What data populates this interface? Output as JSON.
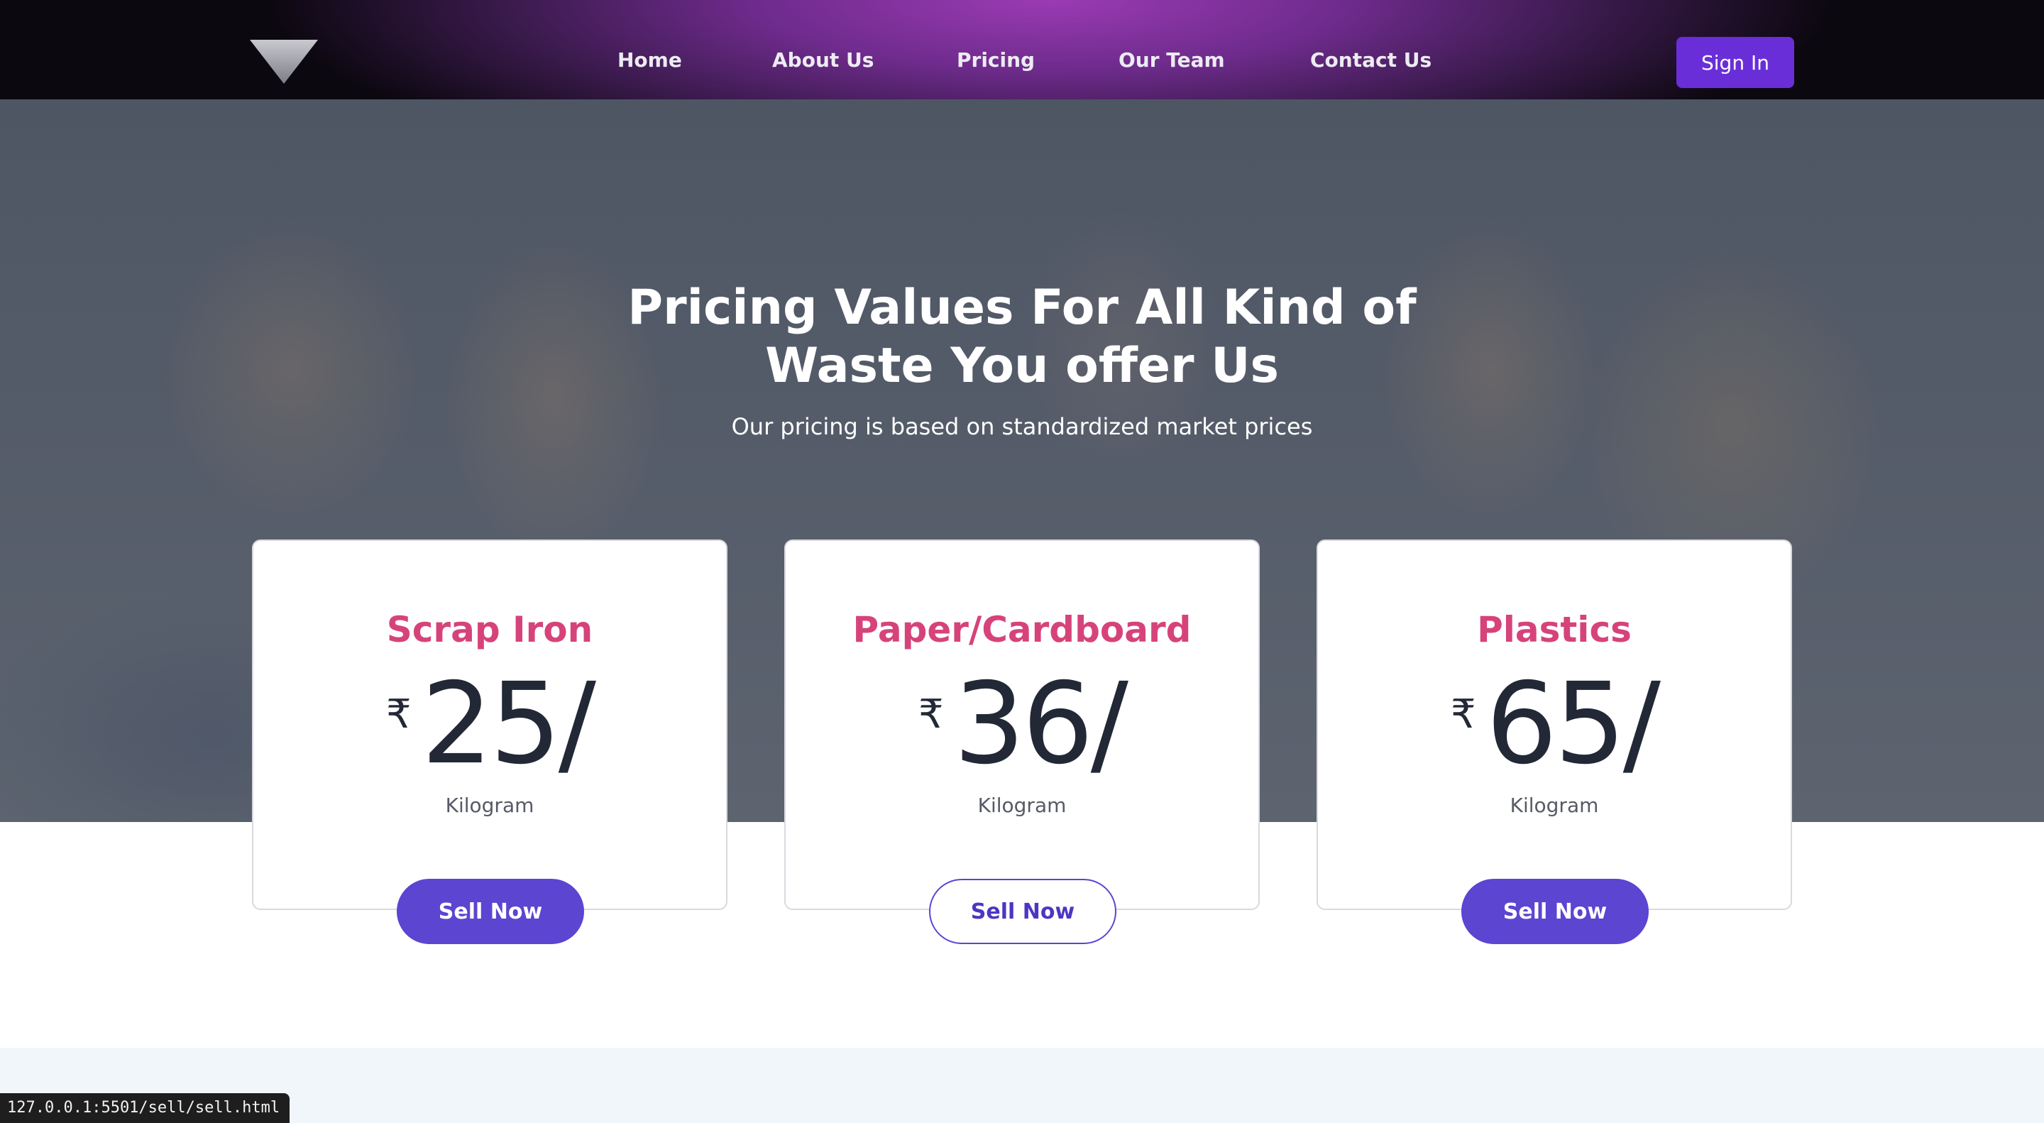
{
  "nav": {
    "logo_icon": "triangle-logo-icon",
    "links": [
      "Home",
      "About Us",
      "Pricing",
      "Our Team",
      "Contact Us"
    ],
    "signin_label": "Sign In",
    "signin_color": "#6a2ed8"
  },
  "hero": {
    "title": "Pricing Values For All Kind of Waste You offer Us",
    "subtitle": "Our pricing is based on standardized market prices"
  },
  "cards": [
    {
      "name": "Scrap Iron",
      "currency": "₹",
      "amount": "25/",
      "unit": "Kilogram",
      "button": "Sell Now",
      "button_style": "solid"
    },
    {
      "name": "Paper/Cardboard",
      "currency": "₹",
      "amount": "36/",
      "unit": "Kilogram",
      "button": "Sell Now",
      "button_style": "outline"
    },
    {
      "name": "Plastics",
      "currency": "₹",
      "amount": "65/",
      "unit": "Kilogram",
      "button": "Sell Now",
      "button_style": "solid"
    }
  ],
  "colors": {
    "accent": "#5b45d1",
    "card_title": "#d6437a",
    "price_text": "#222836"
  },
  "status_bar": {
    "url": "127.0.0.1:5501/sell/sell.html"
  }
}
